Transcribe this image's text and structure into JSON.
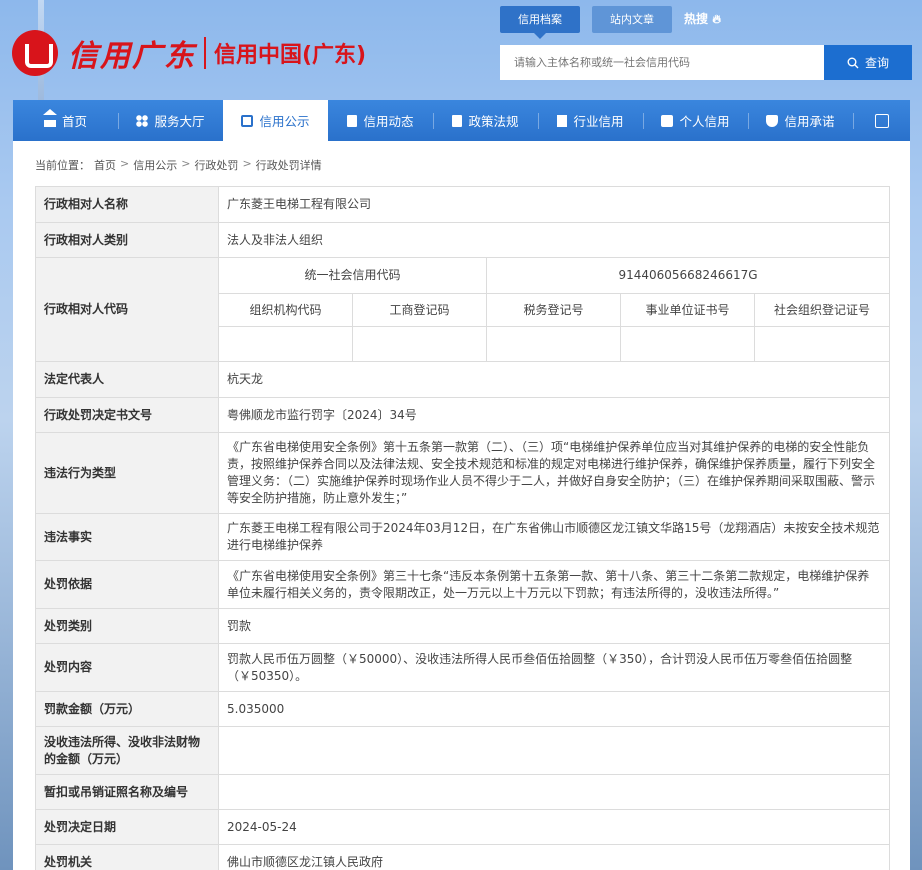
{
  "header": {
    "logo_text": "信用广东",
    "site_title": "信用中国(广东)",
    "tabs": [
      "信用档案",
      "站内文章"
    ],
    "hot_label": "热搜",
    "search": {
      "placeholder": "请输入主体名称或统一社会信用代码",
      "button": "查询"
    }
  },
  "nav": {
    "items": [
      {
        "label": "首页",
        "icon": "home-icon"
      },
      {
        "label": "服务大厅",
        "icon": "grid-icon"
      },
      {
        "label": "信用公示",
        "icon": "briefcase-icon",
        "active": true
      },
      {
        "label": "信用动态",
        "icon": "document-icon"
      },
      {
        "label": "政策法规",
        "icon": "book-icon"
      },
      {
        "label": "行业信用",
        "icon": "building-icon"
      },
      {
        "label": "个人信用",
        "icon": "user-icon"
      },
      {
        "label": "信用承诺",
        "icon": "shield-icon"
      }
    ]
  },
  "breadcrumb": {
    "prefix": "当前位置：",
    "items": [
      "首页",
      "信用公示",
      "行政处罚",
      "行政处罚详情"
    ]
  },
  "detail": {
    "name_label": "行政相对人名称",
    "name": "广东菱王电梯工程有限公司",
    "type_label": "行政相对人类别",
    "type": "法人及非法人组织",
    "code_label": "行政相对人代码",
    "uscc_label": "统一社会信用代码",
    "uscc": "91440605668246617G",
    "code_headers": [
      "组织机构代码",
      "工商登记码",
      "税务登记号",
      "事业单位证书号",
      "社会组织登记证号"
    ],
    "legal_rep_label": "法定代表人",
    "legal_rep": "杭天龙",
    "doc_no_label": "行政处罚决定书文号",
    "doc_no": "粤佛顺龙市监行罚字〔2024〕34号",
    "violation_type_label": "违法行为类型",
    "violation_type": "《广东省电梯使用安全条例》第十五条第一款第（二）、（三）项“电梯维护保养单位应当对其维护保养的电梯的安全性能负责，按照维护保养合同以及法律法规、安全技术规范和标准的规定对电梯进行维护保养，确保维护保养质量，履行下列安全管理义务：（二）实施维护保养时现场作业人员不得少于二人，并做好自身安全防护；（三）在维护保养期间采取围蔽、警示等安全防护措施，防止意外发生；”",
    "facts_label": "违法事实",
    "facts": "广东菱王电梯工程有限公司于2024年03月12日，在广东省佛山市顺德区龙江镇文华路15号（龙翔酒店）未按安全技术规范进行电梯维护保养",
    "basis_label": "处罚依据",
    "basis": "《广东省电梯使用安全条例》第三十七条“违反本条例第十五条第一款、第十八条、第三十二条第二款规定，电梯维护保养单位未履行相关义务的，责令限期改正，处一万元以上十万元以下罚款；有违法所得的，没收违法所得。”",
    "category_label": "处罚类别",
    "category": "罚款",
    "content_label": "处罚内容",
    "content": "罚款人民币伍万圆整（￥50000）、没收违法所得人民币叁佰伍拾圆整（￥350），合计罚没人民币伍万零叁佰伍拾圆整（￥50350）。",
    "fine_label": "罚款金额（万元）",
    "fine": "5.035000",
    "confiscation_label": "没收违法所得、没收非法财物的金额（万元）",
    "confiscation": "",
    "license_label": "暂扣或吊销证照名称及编号",
    "license": "",
    "date_label": "处罚决定日期",
    "date": "2024-05-24",
    "authority_label": "处罚机关",
    "authority": "佛山市顺德区龙江镇人民政府"
  }
}
